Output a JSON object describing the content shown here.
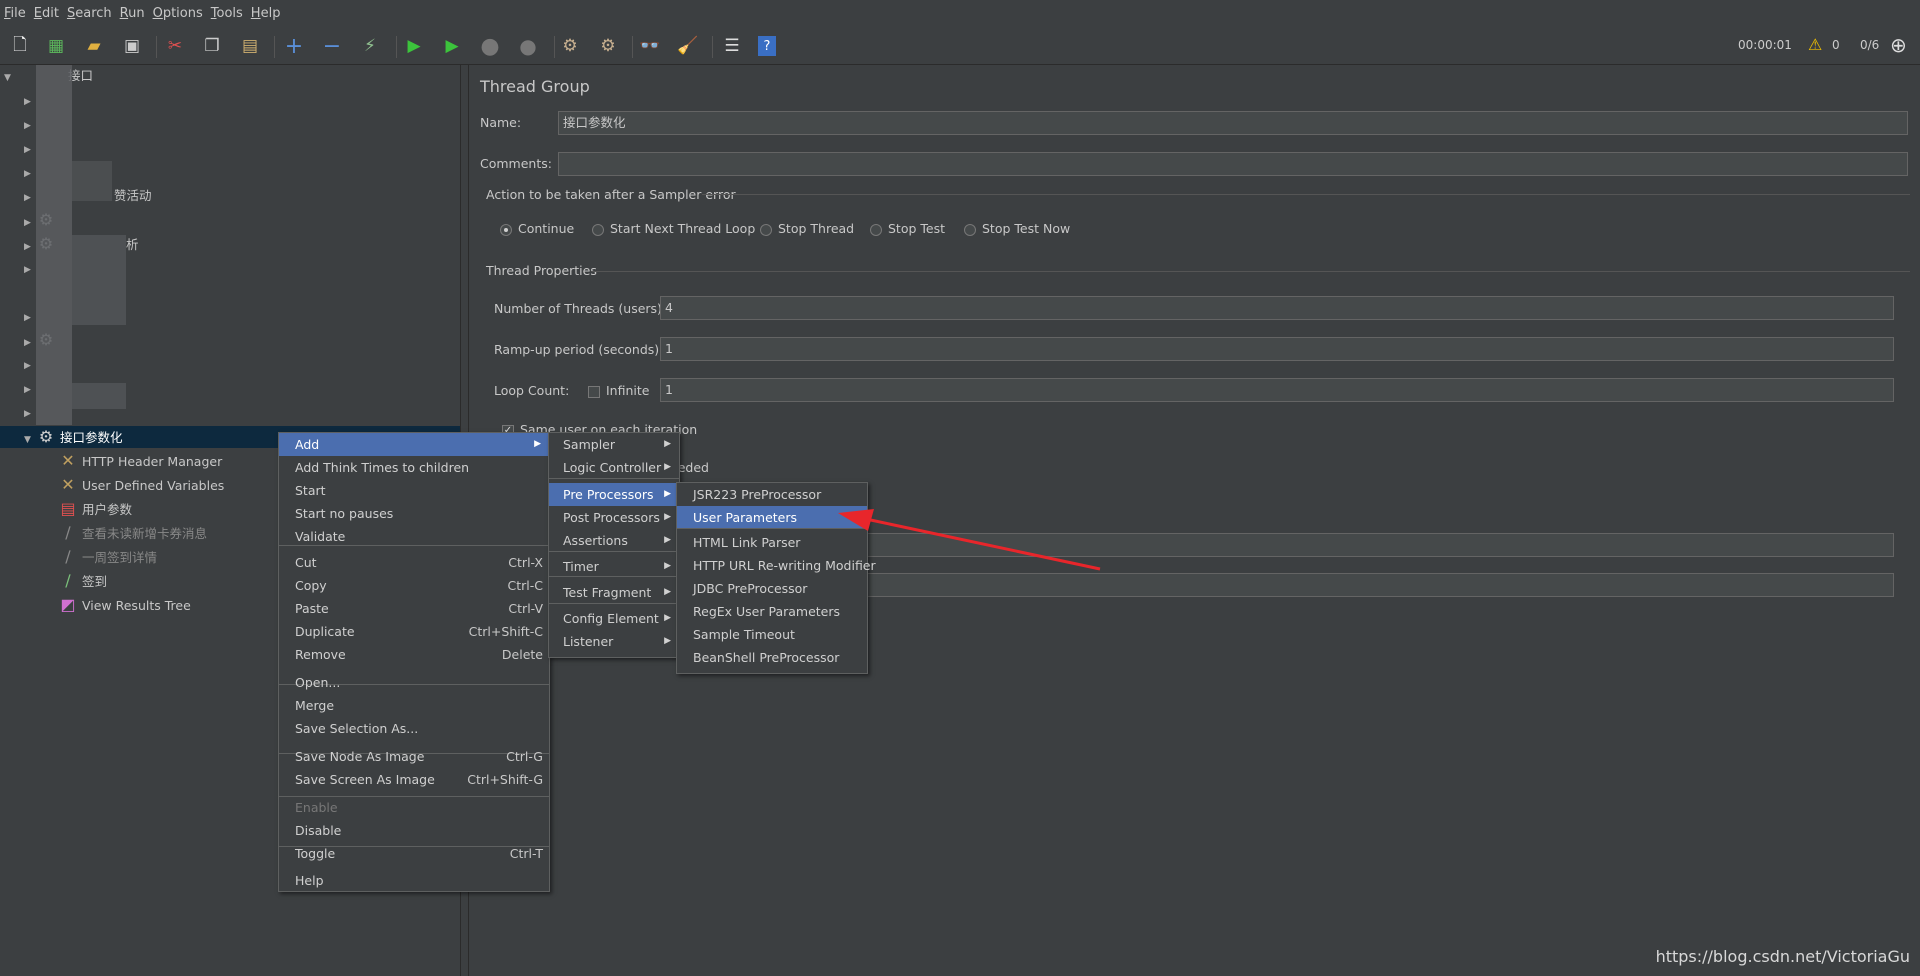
{
  "menubar": [
    "File",
    "Edit",
    "Search",
    "Run",
    "Options",
    "Tools",
    "Help"
  ],
  "status": {
    "timer": "00:00:01",
    "warnings": "0",
    "threads": "0/6"
  },
  "tree": {
    "root_suffix": "接口",
    "item_suffix_1": "赞活动",
    "item_suffix_2": "析",
    "selected": "接口参数化",
    "children": [
      "HTTP Header Manager",
      "User Defined Variables",
      "用户参数",
      "查看未读新增卡券消息",
      "一周签到详情",
      "签到",
      "View Results Tree"
    ]
  },
  "panel": {
    "title": "Thread Group",
    "name_label": "Name:",
    "name_value": "接口参数化",
    "comments_label": "Comments:",
    "comments_value": "",
    "error_group": "Action to be taken after a Sampler error",
    "error_options": [
      "Continue",
      "Start Next Thread Loop",
      "Stop Thread",
      "Stop Test",
      "Stop Test Now"
    ],
    "thread_group": "Thread Properties",
    "threads_label": "Number of Threads (users):",
    "threads_value": "4",
    "rampup_label": "Ramp-up period (seconds):",
    "rampup_value": "1",
    "loop_label": "Loop Count:",
    "infinite_label": "Infinite",
    "loop_value": "1",
    "same_user": "Same user on each iteration",
    "partial_text": "eeded"
  },
  "context_menu": {
    "items": [
      {
        "label": "Add",
        "sub": true
      },
      {
        "label": "Add Think Times to children"
      },
      {
        "label": "Start"
      },
      {
        "label": "Start no pauses"
      },
      {
        "label": "Validate"
      },
      {
        "label": "Cut",
        "acc": "Ctrl-X"
      },
      {
        "label": "Copy",
        "acc": "Ctrl-C"
      },
      {
        "label": "Paste",
        "acc": "Ctrl-V"
      },
      {
        "label": "Duplicate",
        "acc": "Ctrl+Shift-C"
      },
      {
        "label": "Remove",
        "acc": "Delete"
      },
      {
        "label": "Open..."
      },
      {
        "label": "Merge"
      },
      {
        "label": "Save Selection As..."
      },
      {
        "label": "Save Node As Image",
        "acc": "Ctrl-G"
      },
      {
        "label": "Save Screen As Image",
        "acc": "Ctrl+Shift-G"
      },
      {
        "label": "Enable"
      },
      {
        "label": "Disable"
      },
      {
        "label": "Toggle",
        "acc": "Ctrl-T"
      },
      {
        "label": "Help"
      }
    ]
  },
  "add_menu": [
    "Sampler",
    "Logic Controller",
    "Pre Processors",
    "Post Processors",
    "Assertions",
    "Timer",
    "Test Fragment",
    "Config Element",
    "Listener"
  ],
  "pre_menu": [
    "JSR223 PreProcessor",
    "User Parameters",
    "HTML Link Parser",
    "HTTP URL Re-writing Modifier",
    "JDBC PreProcessor",
    "RegEx User Parameters",
    "Sample Timeout",
    "BeanShell PreProcessor"
  ],
  "watermark": "https://blog.csdn.net/VictoriaGu",
  "colors": {
    "highlight": "#4b6eaf",
    "arrow": "#e8262b",
    "bg": "#3c3f41"
  }
}
